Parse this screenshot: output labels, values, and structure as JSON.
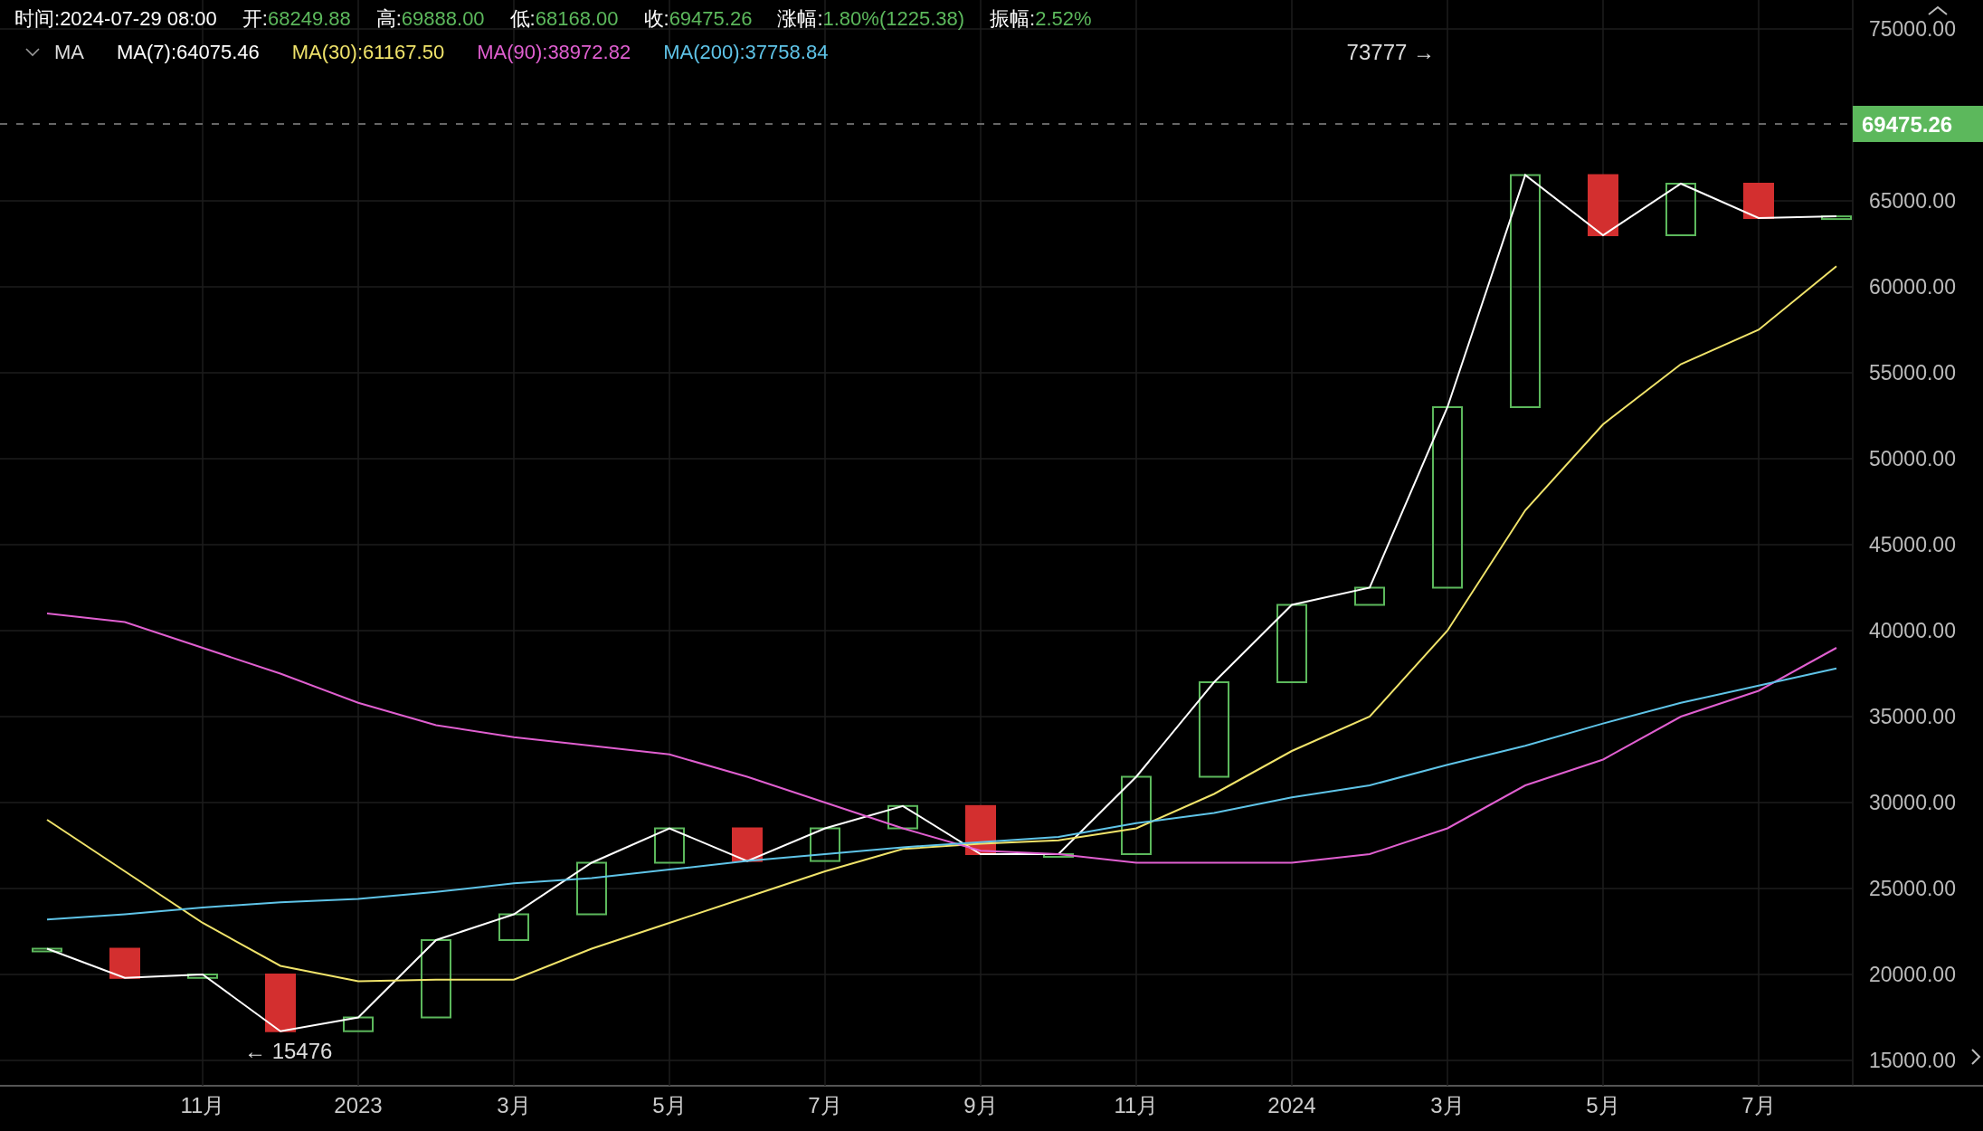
{
  "header": {
    "items": [
      {
        "label": "时间:",
        "value": "2024-07-29 08:00",
        "color": "#ffffff"
      },
      {
        "label": "开:",
        "value": "68249.88",
        "color": "#5cb85c"
      },
      {
        "label": "高:",
        "value": "69888.00",
        "color": "#5cb85c"
      },
      {
        "label": "低:",
        "value": "68168.00",
        "color": "#5cb85c"
      },
      {
        "label": "收:",
        "value": "69475.26",
        "color": "#5cb85c"
      },
      {
        "label": "涨幅:",
        "value": "1.80%(1225.38)",
        "color": "#5cb85c"
      },
      {
        "label": "振幅:",
        "value": "2.52%",
        "color": "#5cb85c"
      }
    ]
  },
  "indicator": {
    "name": "MA",
    "expanded": true,
    "values": [
      ":64075.46",
      ":61167.50",
      ":38972.82",
      ":37758.84"
    ]
  },
  "chart_data": {
    "type": "line",
    "grid": true,
    "ref_lines": [
      {
        "axis": "y",
        "value": 69475.26,
        "label": "69475.26",
        "color": "#888888"
      }
    ],
    "categories": [
      null,
      null,
      "11月",
      null,
      "2023",
      null,
      "3月",
      null,
      "5月",
      null,
      "7月",
      null,
      "9月",
      null,
      "11月",
      null,
      "2024",
      null,
      "3月",
      null,
      "5月",
      null,
      "7月",
      null
    ],
    "ylim": [
      15000,
      75000
    ],
    "yticks": [
      {
        "value": 15000,
        "label": "15000.00"
      },
      {
        "value": 20000,
        "label": "20000.00"
      },
      {
        "value": 25000,
        "label": "25000.00"
      },
      {
        "value": 30000,
        "label": "30000.00"
      },
      {
        "value": 35000,
        "label": "35000.00"
      },
      {
        "value": 40000,
        "label": "40000.00"
      },
      {
        "value": 45000,
        "label": "45000.00"
      },
      {
        "value": 50000,
        "label": "50000.00"
      },
      {
        "value": 55000,
        "label": "55000.00"
      },
      {
        "value": 60000,
        "label": "60000.00"
      },
      {
        "value": 65000,
        "label": "65000.00"
      },
      {
        "value": 75000,
        "label": "75000.00"
      }
    ],
    "series": [
      {
        "name": "MA(7)",
        "color": "#ffffff",
        "values": [
          21500,
          19800,
          20000,
          16700,
          17500,
          22000,
          23500,
          26500,
          28500,
          26600,
          28500,
          29800,
          27000,
          27000,
          31500,
          37000,
          41500,
          42500,
          53000,
          66500,
          63000,
          66000,
          64000,
          64100
        ]
      },
      {
        "name": "MA(30)",
        "color": "#f0e36a",
        "values": [
          29000,
          26000,
          23000,
          20500,
          19600,
          19700,
          19700,
          21500,
          23000,
          24500,
          26000,
          27300,
          27600,
          27800,
          28500,
          30500,
          33000,
          35000,
          40000,
          47000,
          52000,
          55500,
          57500,
          61200
        ]
      },
      {
        "name": "MA(90)",
        "color": "#e05fd0",
        "values": [
          41000,
          40500,
          39000,
          37500,
          35800,
          34500,
          33800,
          33300,
          32800,
          31500,
          30000,
          28500,
          27200,
          27000,
          26500,
          26500,
          26500,
          27000,
          28500,
          31000,
          32500,
          35000,
          36500,
          39000
        ]
      },
      {
        "name": "MA(200)",
        "color": "#5fc4e8",
        "values": [
          23200,
          23500,
          23900,
          24200,
          24400,
          24800,
          25300,
          25600,
          26100,
          26600,
          27000,
          27400,
          27700,
          28000,
          28800,
          29400,
          30300,
          31000,
          32200,
          33300,
          34600,
          35800,
          36800,
          37800
        ]
      }
    ],
    "annotations": [
      "73777 →",
      "← 15476"
    ]
  }
}
